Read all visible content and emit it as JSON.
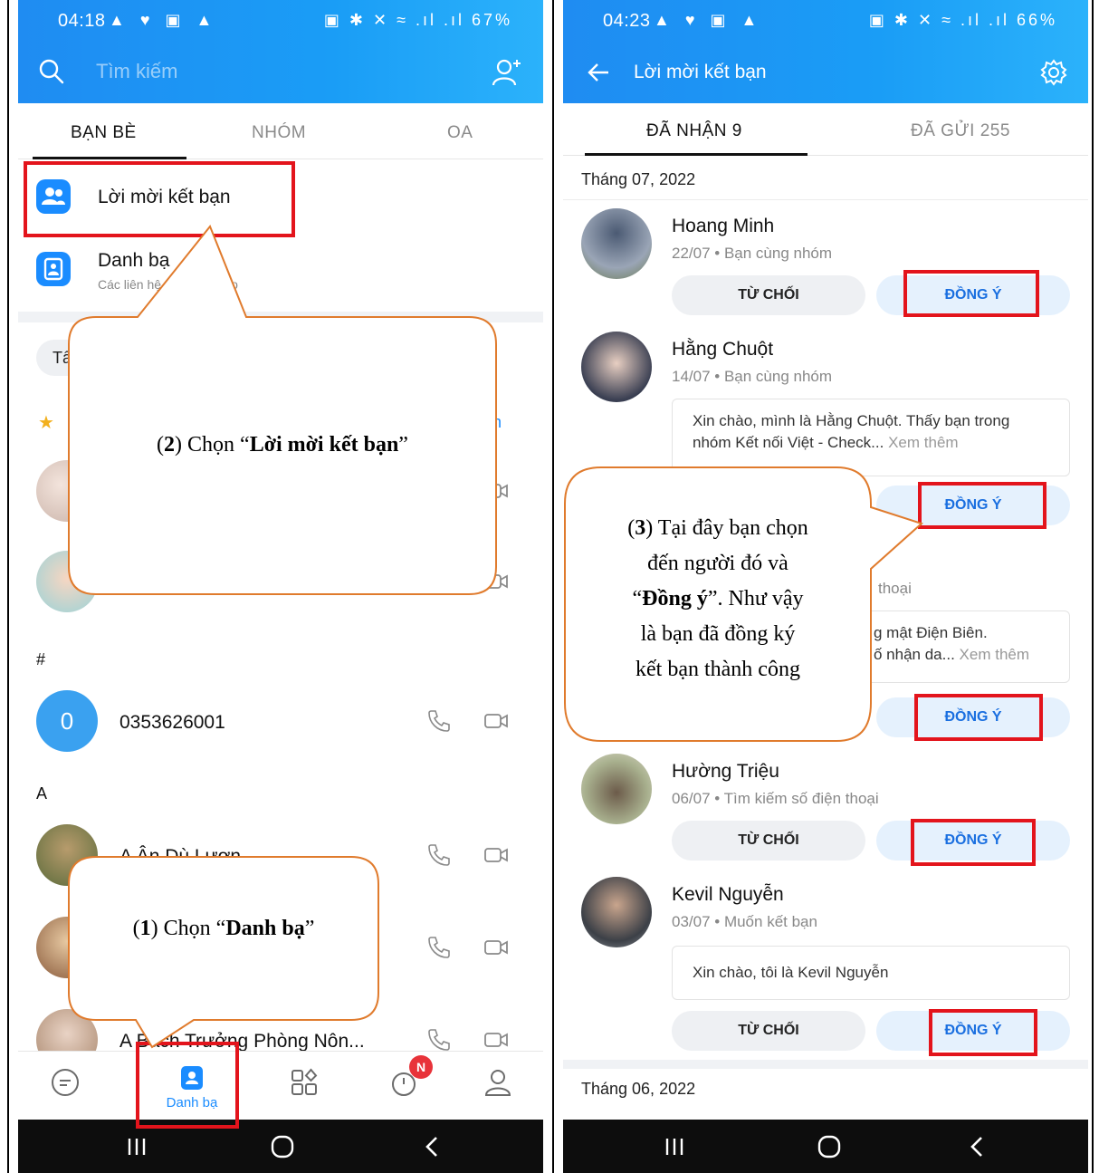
{
  "left": {
    "status": {
      "time": "04:18",
      "icons_left": "▲ ♥ ▣ ▲",
      "right": "▣ ✱ ✕ ≈ .ıl .ıl 67%"
    },
    "search_placeholder": "Tìm kiếm",
    "tabs": [
      "BẠN BÈ",
      "NHÓM",
      "OA"
    ],
    "menu": {
      "friend_requests": "Lời mời kết bạn",
      "contacts": "Danh bạ",
      "contacts_sub": "Các liên hệ có dùng Zalo"
    },
    "chip": "Tất cả",
    "see_all_partial": "n",
    "section_hash": "#",
    "section_a": "A",
    "contacts": [
      {
        "name": "0353626001",
        "avatar_letter": "0"
      },
      {
        "name": "A Ân Dù Lượn"
      },
      {
        "name": ""
      },
      {
        "name": "A Bach Trưởng Phòng Nôn..."
      }
    ],
    "nav": {
      "contacts_label": "Danh bạ",
      "badge": "N"
    }
  },
  "right": {
    "status": {
      "time": "04:23",
      "icons_left": "▲ ♥ ▣ ▲",
      "right": "▣ ✱ ✕ ≈ .ıl .ıl 66%"
    },
    "title": "Lời mời kết bạn",
    "tabs": {
      "received": "ĐÃ NHẬN 9",
      "sent": "ĐÃ GỬI 255"
    },
    "month_1": "Tháng 07, 2022",
    "month_2": "Tháng 06, 2022",
    "requests": [
      {
        "name": "Hoang Minh",
        "meta": "22/07 • Bạn cùng nhóm"
      },
      {
        "name": "Hằng Chuột",
        "meta": "14/07 • Bạn cùng nhóm",
        "msg": "Xin chào, mình là Hằng Chuột. Thấy bạn trong nhóm Kết nối Việt - Check...",
        "more": "Xem thêm"
      },
      {
        "meta_partial": "thoại",
        "msg_line1": "g mật Điện Biên.",
        "msg_line2": "ố nhận da...",
        "more": "Xem thêm"
      },
      {
        "name": "Hường Triệu",
        "meta": "06/07 • Tìm kiếm số điện thoại"
      },
      {
        "name": "Kevil Nguyễn",
        "meta": "03/07 • Muốn kết bạn",
        "msg": "Xin chào, tôi là Kevil Nguyễn"
      }
    ],
    "btn_reject": "TỪ CHỐI",
    "btn_accept": "ĐỒNG Ý"
  },
  "callouts": {
    "c1": {
      "num": "1",
      "pre": "(",
      "mid": ") Chọn “",
      "bold": "Danh bạ",
      "post": "”"
    },
    "c2": {
      "num": "2",
      "pre": "(",
      "mid": ") Chọn “",
      "bold": "Lời mời kết bạn",
      "post": "”"
    },
    "c3": {
      "num": "3",
      "line1": ") Tại đây bạn chọn",
      "line2": "đến người đó và",
      "line3_bold": "Đồng ý",
      "line3_post": "”. Như vậy",
      "line4": "là bạn đã đồng ký",
      "line5": "kết bạn thành công"
    }
  },
  "colors": {
    "header": "#1f8cf2",
    "accent": "#1a8cff",
    "annotation_red": "#e3141c",
    "callout_stroke": "#e07b2d"
  }
}
